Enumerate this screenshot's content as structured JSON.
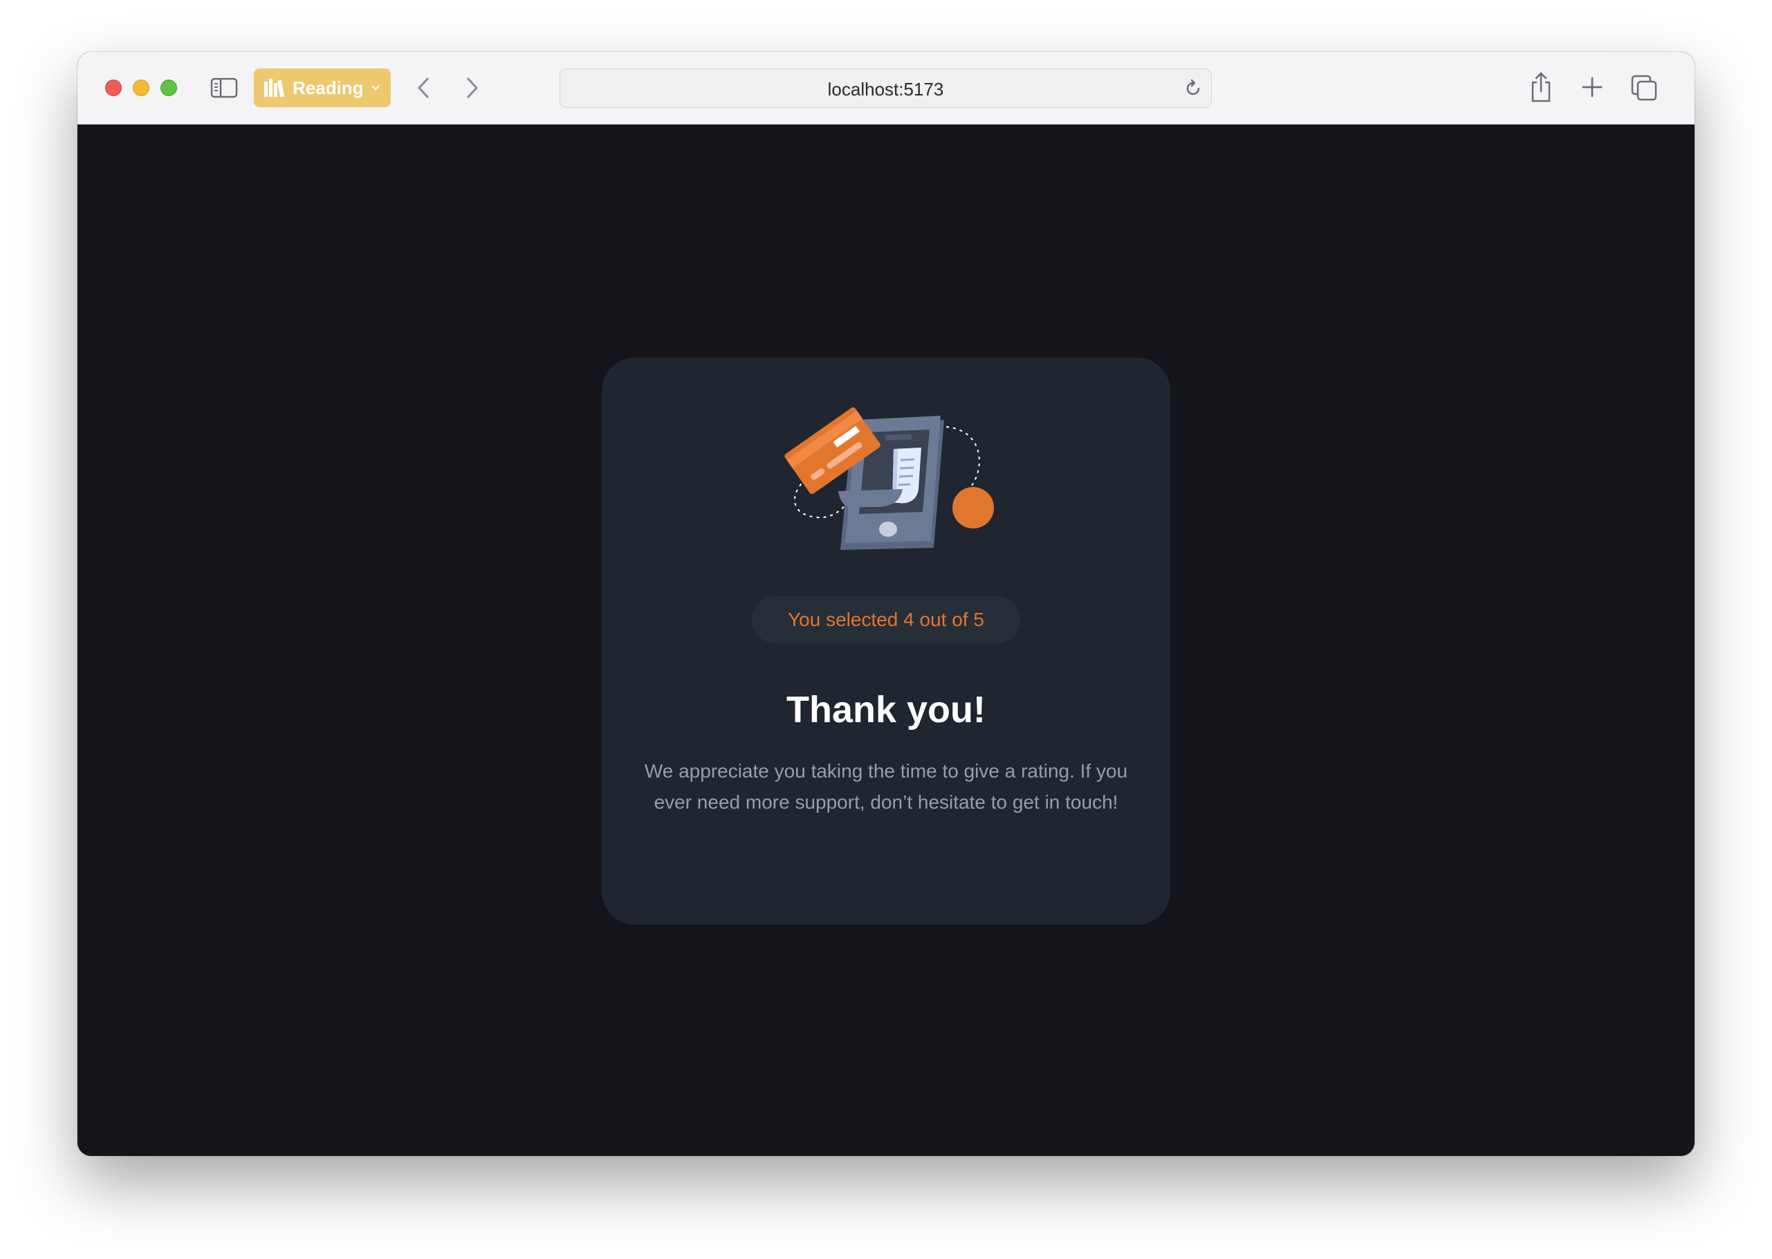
{
  "browser": {
    "reading_label": "Reading",
    "url": "localhost:5173"
  },
  "rating": {
    "selected_text": "You selected 4 out of 5",
    "title": "Thank you!",
    "description": "We appreciate you taking the time to give a rating. If you ever need more support, don’t hesitate to get in touch!"
  },
  "colors": {
    "accent": "#e2762f",
    "card_background": "#202630",
    "page_background": "#14151a",
    "reading_button": "#ecc96e"
  },
  "icons": [
    "sidebar-icon",
    "reading-list-icon",
    "chevron-down-icon",
    "back-icon",
    "forward-icon",
    "reload-icon",
    "share-icon",
    "new-tab-icon",
    "tabs-overview-icon",
    "payment-illustration"
  ]
}
